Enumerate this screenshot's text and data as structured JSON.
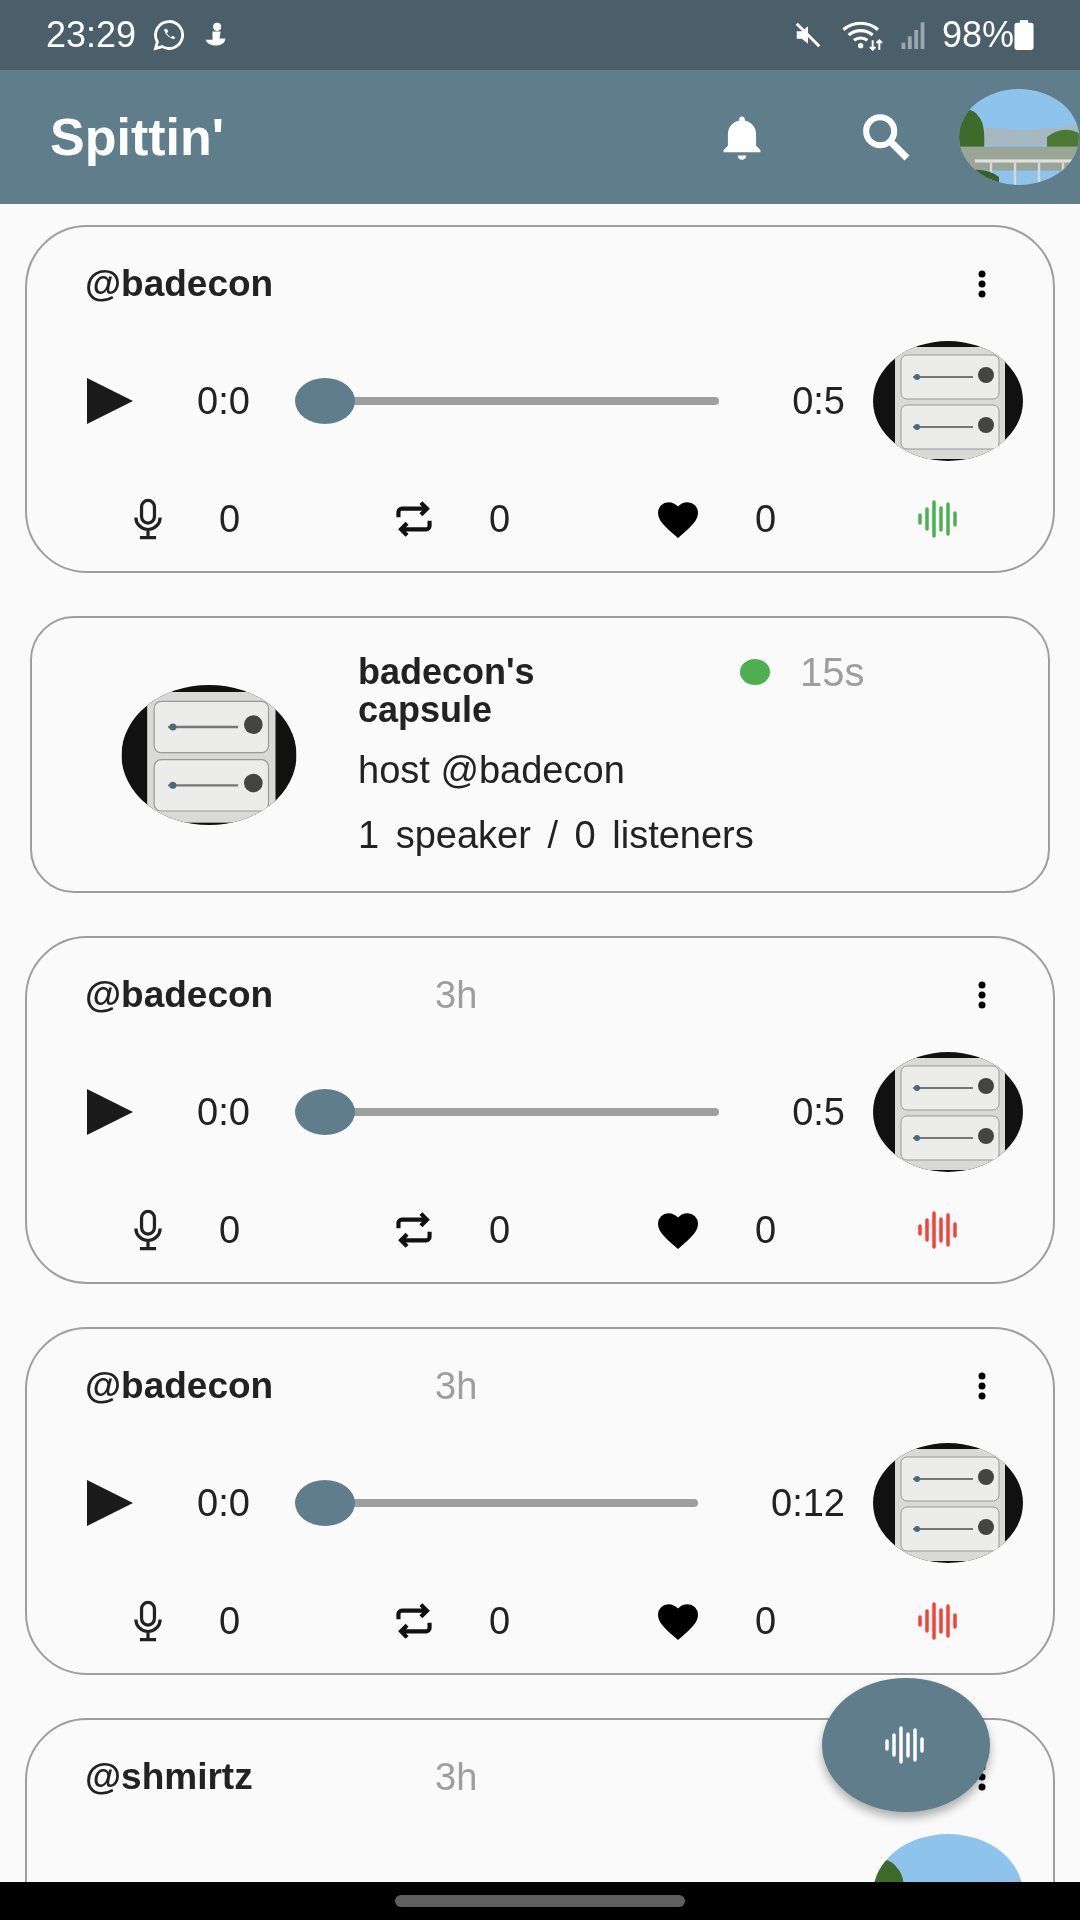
{
  "status_bar": {
    "time": "23:29",
    "battery": "98%"
  },
  "app_bar": {
    "title": "Spittin'"
  },
  "feed": [
    {
      "kind": "post",
      "user": "@badecon",
      "position": "0:0",
      "level": 0,
      "duration": "0:5",
      "comments": "0",
      "reposts": "0",
      "likes": "0",
      "color": "#4caf50"
    },
    {
      "kind": "capsule",
      "title": "badecon's capsule",
      "color": "#4caf50",
      "age": "15s",
      "host": "host @badecon",
      "audience": "1 speaker / 0 listeners"
    },
    {
      "kind": "post",
      "user": "@badecon",
      "time": "3h",
      "position": "0:0",
      "level": 0,
      "duration": "0:5",
      "comments": "0",
      "reposts": "0",
      "likes": "0",
      "color": "#f44336"
    },
    {
      "kind": "post",
      "user": "@badecon",
      "time": "3h",
      "position": "0:0",
      "level": 0,
      "duration": "0:12",
      "comments": "0",
      "reposts": "0",
      "likes": "0",
      "color": "#f44336"
    },
    {
      "kind": "post_cut",
      "user": "@shmirtz",
      "time": "3h"
    }
  ]
}
